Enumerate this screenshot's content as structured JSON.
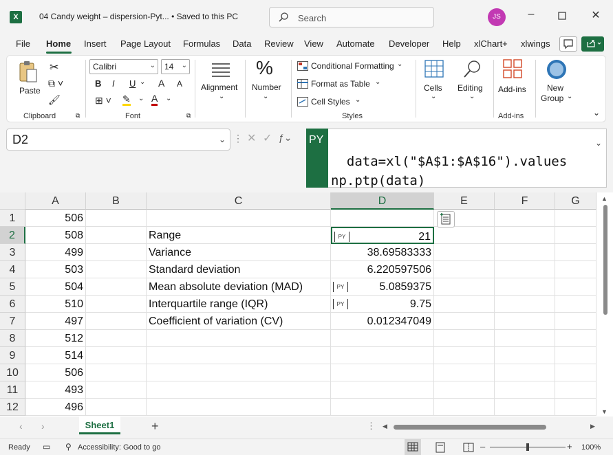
{
  "title_bar": {
    "app_icon_label": "X",
    "document_title": "04 Candy weight – dispersion-Pyt... • Saved to this PC",
    "search_placeholder": "Search",
    "user_initials": "JS"
  },
  "menu": {
    "tabs": [
      "File",
      "Home",
      "Insert",
      "Page Layout",
      "Formulas",
      "Data",
      "Review",
      "View",
      "Automate",
      "Developer",
      "Help",
      "xlChart+",
      "xlwings"
    ],
    "active": "Home"
  },
  "ribbon": {
    "clipboard": {
      "paste": "Paste",
      "label": "Clipboard"
    },
    "font": {
      "name": "Calibri",
      "size": "14",
      "bold": "B",
      "italic": "I",
      "underline": "U",
      "grow": "A",
      "shrink": "A",
      "font_color": "A",
      "label": "Font"
    },
    "alignment": {
      "label": "Alignment"
    },
    "number": {
      "symbol": "%",
      "label": "Number"
    },
    "styles": {
      "conditional": "Conditional Formatting",
      "table": "Format as Table",
      "cell_styles": "Cell Styles",
      "label": "Styles"
    },
    "cells": {
      "label": "Cells"
    },
    "editing": {
      "label": "Editing"
    },
    "addins": {
      "button": "Add-ins",
      "label": "Add-ins"
    },
    "newgroup": {
      "line1": "New",
      "line2": "Group"
    },
    "accent_color": "#1d6f42"
  },
  "formula_bar": {
    "name_box": "D2",
    "py_badge": "PY",
    "formula": "data=xl(\"$A$1:$A$16\").values\nnp.ptp(data)"
  },
  "grid": {
    "columns": [
      "A",
      "B",
      "C",
      "D",
      "E",
      "F",
      "G"
    ],
    "selected_column": "D",
    "rows": [
      "1",
      "2",
      "3",
      "4",
      "5",
      "6",
      "7",
      "8",
      "9",
      "10",
      "11",
      "12"
    ],
    "selected_row": "2",
    "col_a": [
      "506",
      "508",
      "499",
      "503",
      "504",
      "510",
      "497",
      "512",
      "514",
      "506",
      "493",
      "496"
    ],
    "labels": [
      "",
      "Range",
      "Variance",
      "Standard deviation",
      "Mean absolute deviation (MAD)",
      "Interquartile range (IQR)",
      "Coefficient of variation (CV)",
      "",
      "",
      "",
      "",
      ""
    ],
    "results": [
      "",
      "21",
      "38.69583333",
      "6.220597506",
      "5.0859375",
      "9.75",
      "0.012347049",
      "",
      "",
      "",
      "",
      ""
    ],
    "py_cells": [
      false,
      true,
      false,
      false,
      true,
      true,
      false,
      false,
      false,
      false,
      false,
      false
    ],
    "py_icon_label": "[PY]"
  },
  "sheets": {
    "tabs": [
      "Sheet1"
    ],
    "add": "+"
  },
  "status": {
    "ready": "Ready",
    "accessibility": "Accessibility: Good to go",
    "zoom": "100%"
  }
}
